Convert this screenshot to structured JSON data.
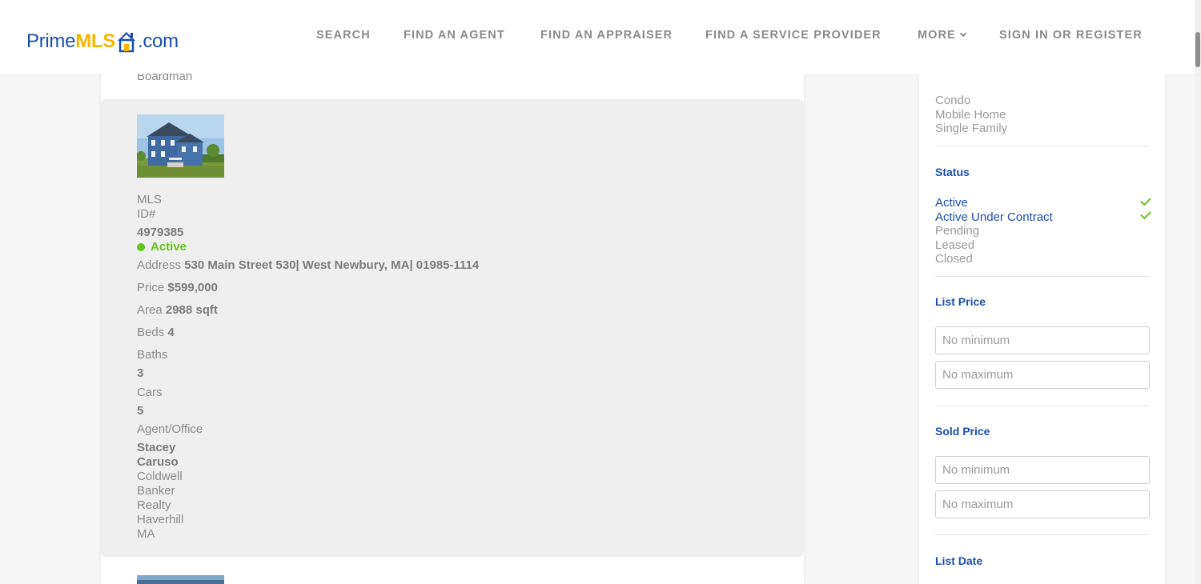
{
  "header": {
    "logo": {
      "prime": "Prime",
      "mls": "MLS",
      "com": ".com"
    },
    "nav": [
      {
        "label": "SEARCH"
      },
      {
        "label": "FIND AN AGENT"
      },
      {
        "label": "FIND AN APPRAISER"
      },
      {
        "label": "FIND A SERVICE PROVIDER"
      },
      {
        "label": "MORE"
      },
      {
        "label": "SIGN IN OR REGISTER"
      }
    ]
  },
  "listings": {
    "previous_city": "Boardman",
    "card": {
      "mls_label_1": "MLS",
      "mls_label_2": "ID#",
      "mls_id": "4979385",
      "status": "Active",
      "address_label": "Address",
      "address": "530 Main Street 530| West Newbury, MA| 01985-1114",
      "price_label": "Price",
      "price": "$599,000",
      "area_label": "Area",
      "area": "2988 sqft",
      "beds_label": "Beds",
      "beds": "4",
      "baths_label": "Baths",
      "baths": "3",
      "cars_label": "Cars",
      "cars": "5",
      "agent_label": "Agent/Office",
      "agent_first": "Stacey",
      "agent_last": "Caruso",
      "office_lines": [
        "Coldwell",
        "Banker",
        "Realty",
        "Haverhill",
        "MA"
      ]
    }
  },
  "sidebar": {
    "property_types": [
      "Condo",
      "Mobile Home",
      "Single Family"
    ],
    "status": {
      "heading": "Status",
      "options": [
        {
          "label": "Active",
          "selected": true
        },
        {
          "label": "Active Under Contract",
          "selected": true
        },
        {
          "label": "Pending",
          "selected": false
        },
        {
          "label": "Leased",
          "selected": false
        },
        {
          "label": "Closed",
          "selected": false
        }
      ]
    },
    "list_price": {
      "heading": "List Price",
      "min_placeholder": "No minimum",
      "max_placeholder": "No maximum"
    },
    "sold_price": {
      "heading": "Sold Price",
      "min_placeholder": "No minimum",
      "max_placeholder": "No maximum"
    },
    "list_date": {
      "heading": "List Date"
    }
  },
  "colors": {
    "brand_blue": "#1a4fb0",
    "brand_yellow": "#f7b500",
    "active_green": "#63c41a",
    "muted_text": "#8a8a8a"
  }
}
